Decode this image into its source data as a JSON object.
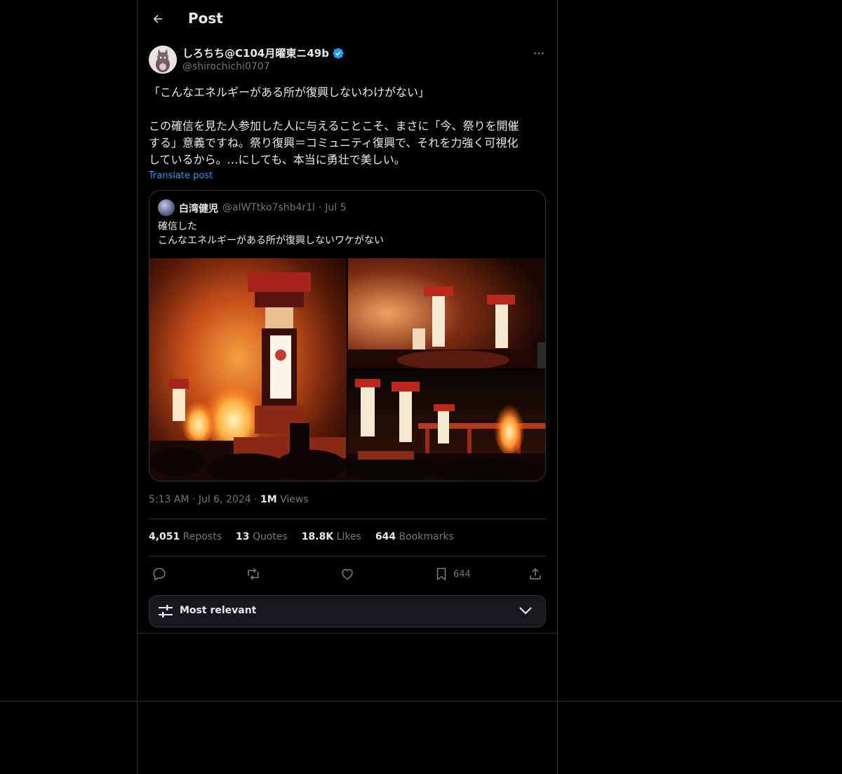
{
  "header": {
    "title": "Post"
  },
  "post": {
    "author": {
      "name": "しろちち@C104月曜東ニ49b",
      "handle": "@shirochichi0707",
      "verified": true
    },
    "lines": [
      "「こんなエネルギーがある所が復興しないわけがない」",
      "この確信を見た人参加した人に与えることこそ、まさに「今、祭りを開催",
      "する」意義ですね。祭り復興＝コミュニティ復興で、それを力強く可視化",
      "しているから。…にしても、本当に勇壮で美しい。"
    ],
    "translate_label": "Translate post",
    "quote": {
      "name": "白湾健児",
      "handle": "@alWTtko7shb4r1l",
      "date": "Jul 5",
      "lines": [
        "確信した",
        "こんなエネルギーがある所が復興しないワケがない"
      ]
    },
    "time": "5:13 AM",
    "date": "Jul 6, 2024",
    "views_count": "1M",
    "views_label": "Views",
    "stats": {
      "reposts": {
        "count": "4,051",
        "label": "Reposts"
      },
      "quotes": {
        "count": "13",
        "label": "Quotes"
      },
      "likes": {
        "count": "18.8K",
        "label": "Likes"
      },
      "bookmarks": {
        "count": "644",
        "label": "Bookmarks"
      }
    },
    "actions": {
      "bookmark_count": "644"
    }
  },
  "sort": {
    "label": "Most relevant"
  },
  "colors": {
    "accent": "#1d9bf0",
    "background": "#000000",
    "border": "#2f3336",
    "muted": "#71767b"
  },
  "icons": [
    "back-arrow-icon",
    "verified-badge-icon",
    "more-icon",
    "reply-icon",
    "repost-icon",
    "like-icon",
    "bookmark-icon",
    "share-icon",
    "sliders-icon",
    "chevron-down-icon"
  ]
}
